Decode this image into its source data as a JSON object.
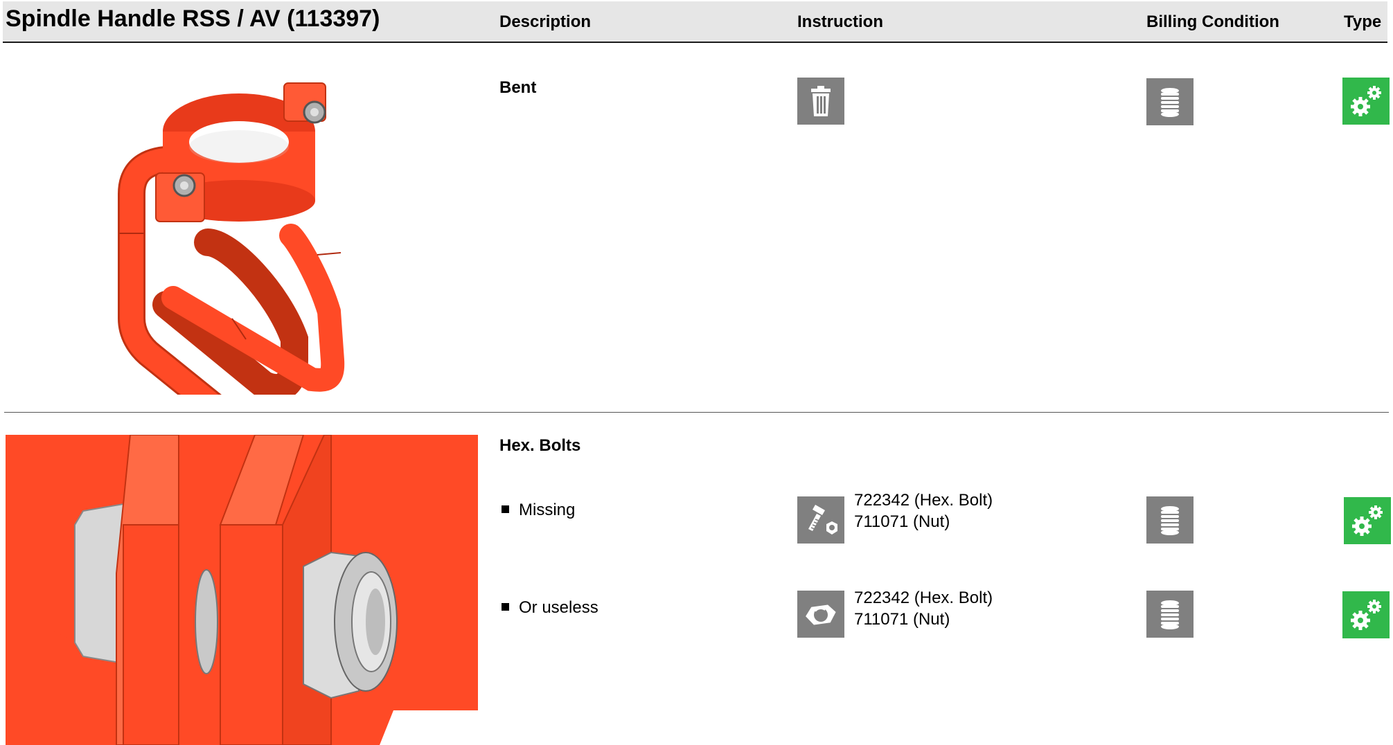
{
  "header": {
    "title": "Spindle Handle RSS / AV (113397)",
    "columns": {
      "description": "Description",
      "instruction": "Instruction",
      "billing": "Billing Condition",
      "type": "Type"
    }
  },
  "sections": [
    {
      "title": "Bent",
      "instruction_icon": "trash-icon",
      "billing_icon": "coin-stack-icon",
      "type_icon": "gears-icon"
    },
    {
      "title": "Hex. Bolts",
      "items": [
        {
          "label": "Missing",
          "instruction_icon": "bolt-nut-icon",
          "parts": [
            "722342 (Hex. Bolt)",
            "711071 (Nut)"
          ],
          "billing_icon": "coin-stack-icon",
          "type_icon": "gears-icon"
        },
        {
          "label": "Or useless",
          "instruction_icon": "hex-nut-icon",
          "parts": [
            "722342 (Hex. Bolt)",
            "711071 (Nut)"
          ],
          "billing_icon": "coin-stack-icon",
          "type_icon": "gears-icon"
        }
      ]
    }
  ],
  "colors": {
    "header_bg": "#e6e6e6",
    "icon_gray": "#808080",
    "icon_green": "#31b84b",
    "part_orange": "#ff4a26"
  }
}
